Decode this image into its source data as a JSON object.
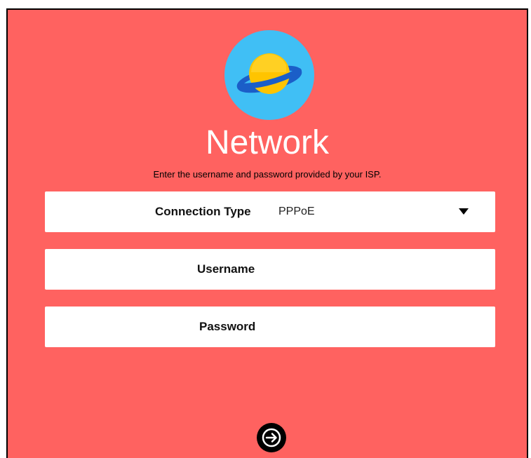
{
  "logo": {
    "icon": "planet-icon"
  },
  "page": {
    "title": "Network",
    "subtitle": "Enter the username and password provided by your ISP."
  },
  "form": {
    "connection_type": {
      "label": "Connection Type",
      "value": "PPPoE"
    },
    "username": {
      "label": "Username",
      "value": ""
    },
    "password": {
      "label": "Password",
      "value": ""
    }
  },
  "next_button": {
    "icon": "arrow-right-icon"
  },
  "colors": {
    "background": "#ff6260",
    "logo_circle": "#40bff5",
    "planet": "#ffc400",
    "ring": "#1b5ec8"
  }
}
